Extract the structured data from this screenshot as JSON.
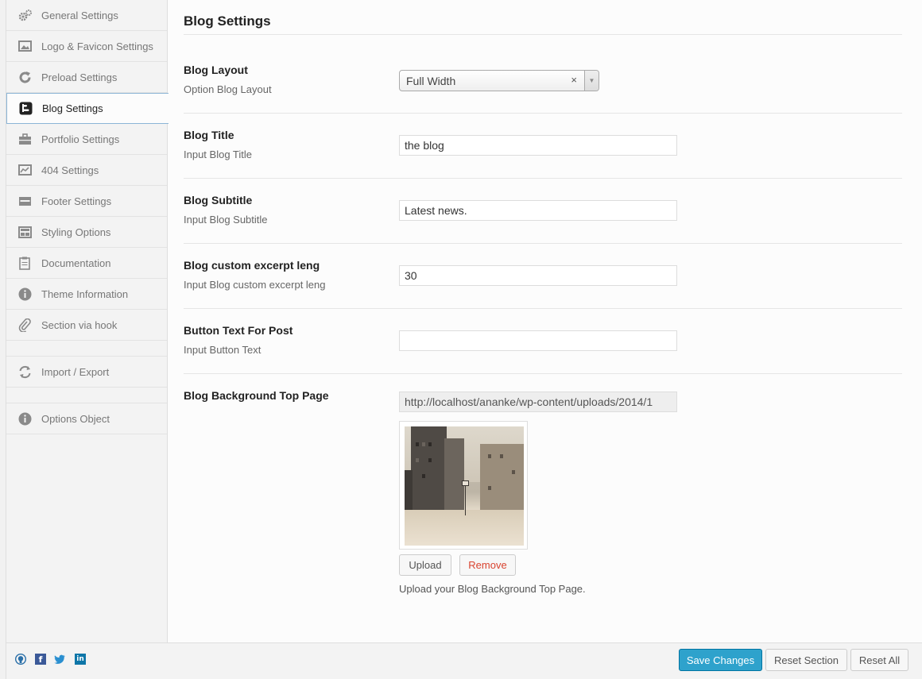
{
  "sidebar": {
    "items": [
      {
        "label": "General Settings",
        "icon": "gears-icon"
      },
      {
        "label": "Logo & Favicon Settings",
        "icon": "image-icon"
      },
      {
        "label": "Preload Settings",
        "icon": "refresh-icon"
      },
      {
        "label": "Blog Settings",
        "icon": "blogger-icon",
        "active": true
      },
      {
        "label": "Portfolio Settings",
        "icon": "briefcase-icon"
      },
      {
        "label": "404 Settings",
        "icon": "chart-icon"
      },
      {
        "label": "Footer Settings",
        "icon": "footer-icon"
      },
      {
        "label": "Styling Options",
        "icon": "layout-icon"
      },
      {
        "label": "Documentation",
        "icon": "clipboard-icon"
      },
      {
        "label": "Theme Information",
        "icon": "info-icon"
      },
      {
        "label": "Section via hook",
        "icon": "paperclip-icon"
      }
    ],
    "import_export": "Import / Export",
    "options_object": "Options Object"
  },
  "main": {
    "title": "Blog Settings",
    "fields": {
      "layout": {
        "label": "Blog Layout",
        "sub": "Option Blog Layout",
        "value": "Full Width",
        "clear": "×",
        "arrow": "▼"
      },
      "title": {
        "label": "Blog Title",
        "sub": "Input Blog Title",
        "value": "the blog"
      },
      "subtitle": {
        "label": "Blog Subtitle",
        "sub": "Input Blog Subtitle",
        "value": "Latest news."
      },
      "excerpt": {
        "label": "Blog custom excerpt leng",
        "sub": "Input Blog custom excerpt leng",
        "value": "30"
      },
      "button_text": {
        "label": "Button Text For Post",
        "sub": "Input Button Text",
        "value": ""
      },
      "background": {
        "label": "Blog Background Top Page",
        "url": "http://localhost/ananke/wp-content/uploads/2014/1",
        "upload": "Upload",
        "remove": "Remove",
        "help": "Upload your Blog Background Top Page."
      }
    }
  },
  "footer": {
    "save": "Save Changes",
    "reset_section": "Reset Section",
    "reset_all": "Reset All"
  },
  "colors": {
    "primary": "#2ea2cc",
    "remove": "#d9432f",
    "facebook": "#3b5998",
    "twitter": "#2a8fd0",
    "linkedin": "#0e76a8"
  }
}
